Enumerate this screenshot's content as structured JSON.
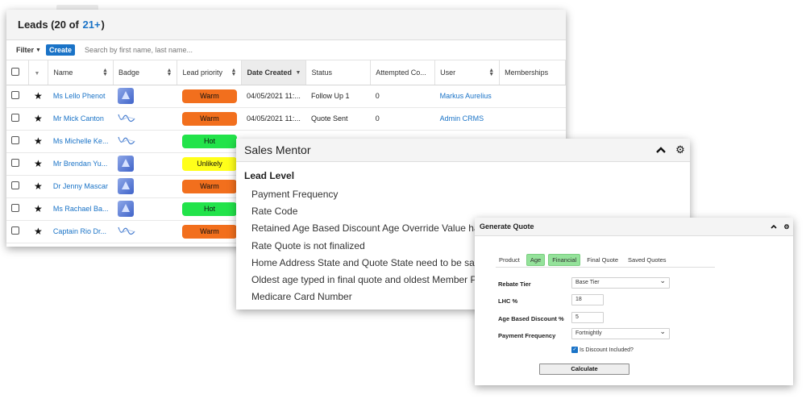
{
  "leads": {
    "title_prefix": "Leads (20 of",
    "title_link": "21+",
    "title_suffix": ")",
    "filter_label": "Filter",
    "create_label": "Create",
    "search_placeholder": "Search by first name, last name...",
    "columns": [
      "Name",
      "Badge",
      "Lead priority",
      "Date Created",
      "Status",
      "Attempted Co...",
      "User",
      "Memberships"
    ],
    "rows": [
      {
        "name": "Ms Lello Phenot",
        "badge": "cube-icon",
        "priority": "Warm",
        "priority_color": "#f26f1d",
        "date": "04/05/2021 11:...",
        "status": "Follow Up 1",
        "attempted": "0",
        "user": "Markus Aurelius"
      },
      {
        "name": "Mr Mick Canton",
        "badge": "wave-icon",
        "priority": "Warm",
        "priority_color": "#f26f1d",
        "date": "04/05/2021 11:...",
        "status": "Quote Sent",
        "attempted": "0",
        "user": "Admin CRMS"
      },
      {
        "name": "Ms Michelle Ke...",
        "badge": "wave-icon",
        "priority": "Hot",
        "priority_color": "#22e34a",
        "date": "",
        "status": "",
        "attempted": "",
        "user": ""
      },
      {
        "name": "Mr Brendan Yu...",
        "badge": "cube-icon",
        "priority": "Unlikely",
        "priority_color": "#ffff1a",
        "date": "",
        "status": "",
        "attempted": "",
        "user": ""
      },
      {
        "name": "Dr Jenny Mascar",
        "badge": "cube-icon",
        "priority": "Warm",
        "priority_color": "#f26f1d",
        "date": "",
        "status": "",
        "attempted": "",
        "user": ""
      },
      {
        "name": "Ms Rachael Ba...",
        "badge": "cube-icon",
        "priority": "Hot",
        "priority_color": "#22e34a",
        "date": "",
        "status": "",
        "attempted": "",
        "user": ""
      },
      {
        "name": "Captain Rio Dr...",
        "badge": "wave-icon",
        "priority": "Warm",
        "priority_color": "#f26f1d",
        "date": "",
        "status": "",
        "attempted": "",
        "user": ""
      }
    ]
  },
  "mentor": {
    "title": "Sales Mentor",
    "section": "Lead Level",
    "items": [
      "Payment Frequency",
      "Rate Code",
      "Retained Age Based Discount Age Override Value has",
      "Rate Quote is not finalized",
      "Home Address State and Quote State need to be sam",
      "Oldest age typed in final quote and oldest Member Pe",
      "Medicare Card Number"
    ]
  },
  "quote": {
    "title": "Generate Quote",
    "tabs": [
      "Product",
      "Age",
      "Financial",
      "Final Quote",
      "Saved Quotes"
    ],
    "rebate_label": "Rebate Tier",
    "rebate_value": "Base Tier",
    "lhc_label": "LHC %",
    "lhc_value": "18",
    "age_discount_label": "Age Based Discount %",
    "age_discount_value": "5",
    "frequency_label": "Payment Frequency",
    "frequency_value": "Fortnightly",
    "discount_checkbox_label": "Is Discount Included?",
    "calculate_label": "Calculate"
  },
  "colors": {
    "link": "#1a73c7",
    "active_tab": "#94e29a"
  }
}
